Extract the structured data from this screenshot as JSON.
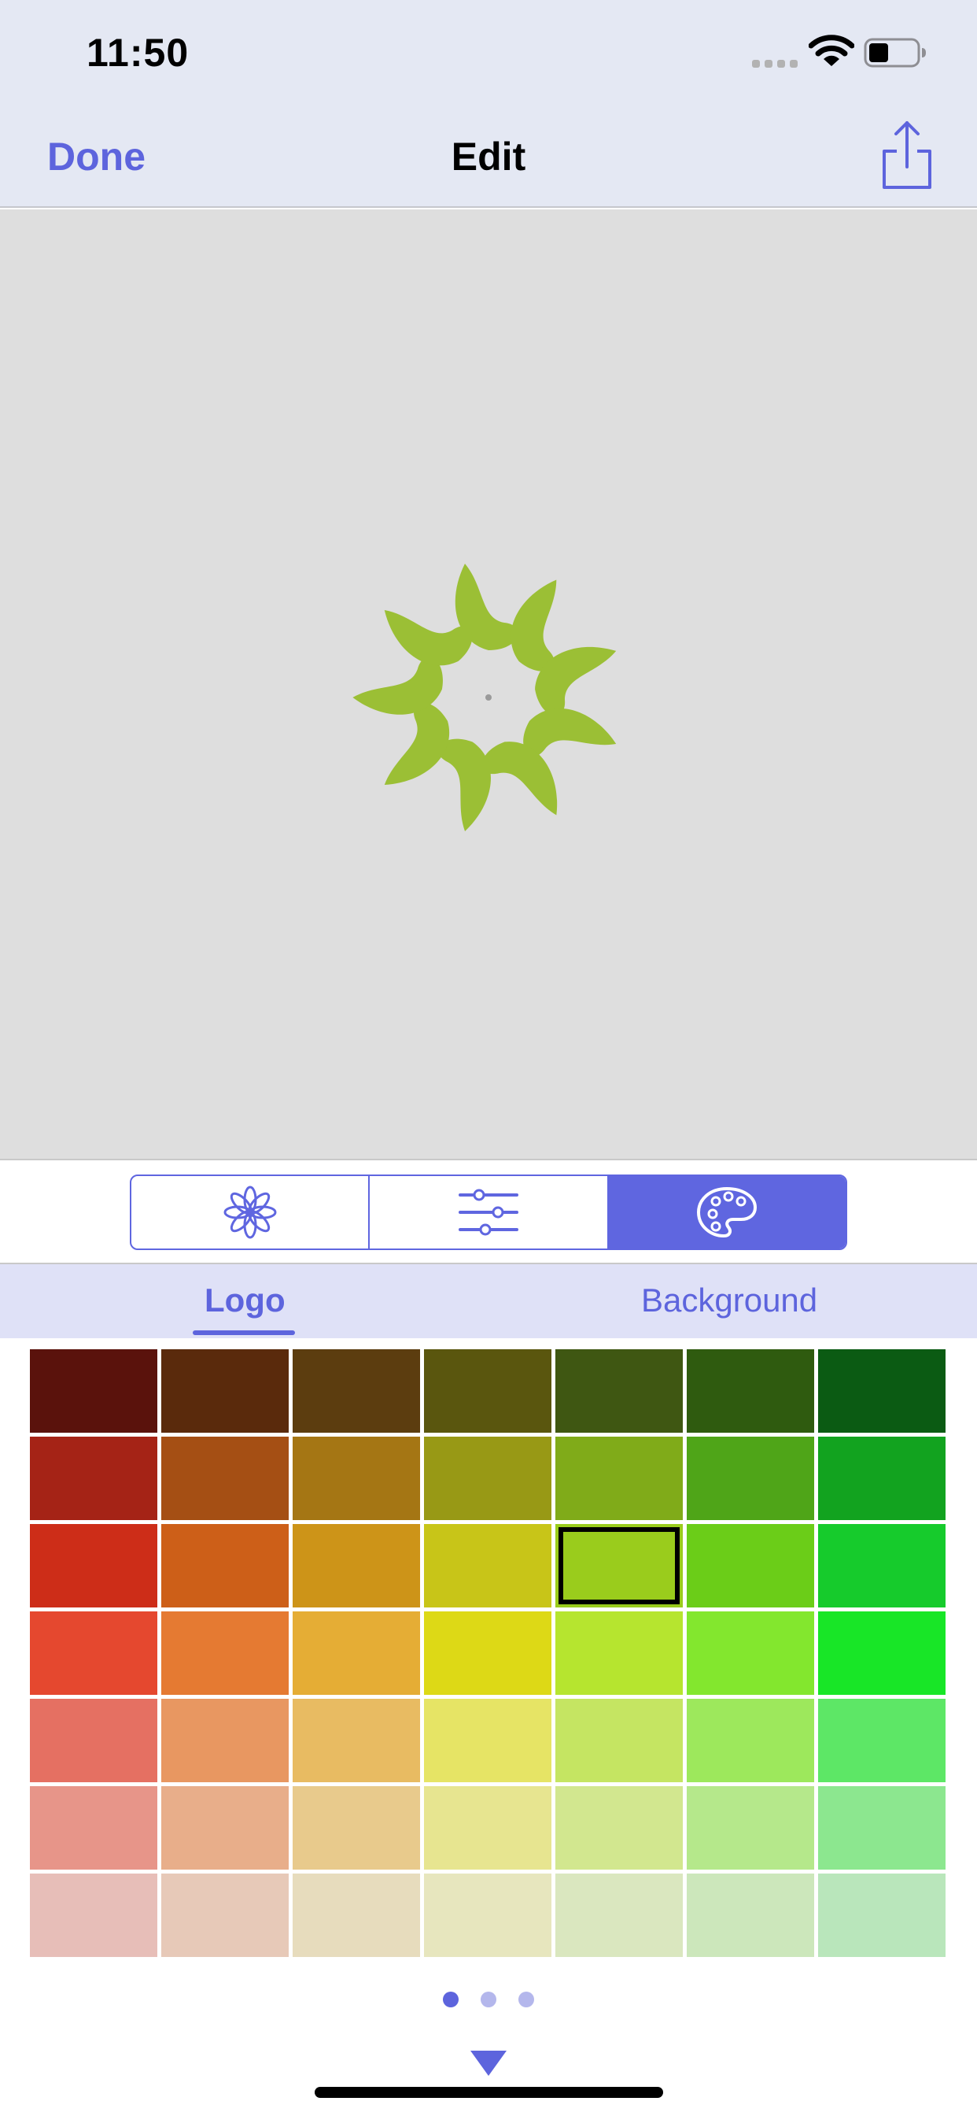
{
  "status_bar": {
    "time": "11:50"
  },
  "nav": {
    "done_label": "Done",
    "title": "Edit"
  },
  "tools": [
    {
      "icon": "flower-icon",
      "active": false
    },
    {
      "icon": "sliders-icon",
      "active": false
    },
    {
      "icon": "palette-icon",
      "active": true
    }
  ],
  "tabs": {
    "logo_label": "Logo",
    "background_label": "Background",
    "selected": "Logo"
  },
  "accent_color": "#5d64dd",
  "logo_color": "#9bbf35",
  "swatch_rows": [
    [
      "#5a120c",
      "#5a2a0c",
      "#5c3d0f",
      "#5a560e",
      "#3f5712",
      "#2f5b0f",
      "#0b5b13"
    ],
    [
      "#a52316",
      "#a54f14",
      "#a57614",
      "#989915",
      "#80ab19",
      "#4fa518",
      "#12a31f"
    ],
    [
      "#cd2d18",
      "#cd5f18",
      "#cd9418",
      "#c8c518",
      "#9acc1c",
      "#6bcd18",
      "#16cb2c"
    ],
    [
      "#e5482f",
      "#e57a32",
      "#e5ad35",
      "#ddd916",
      "#b6e52f",
      "#83e72e",
      "#18e627"
    ],
    [
      "#e57062",
      "#e89761",
      "#e8bb62",
      "#e6e465",
      "#c5e562",
      "#9de85c",
      "#5de766"
    ],
    [
      "#e79589",
      "#e8ae8a",
      "#e8ca8c",
      "#e7e590",
      "#d2e78f",
      "#b5e88b",
      "#8ce78f"
    ],
    [
      "#e7beb8",
      "#e7c9b8",
      "#e7dcbd",
      "#e7e6be",
      "#dae7bf",
      "#cce7bb",
      "#b9e6bb"
    ]
  ],
  "selected_swatch": {
    "row": 2,
    "col": 4
  },
  "pagination": {
    "pages": 3,
    "current": 1
  }
}
